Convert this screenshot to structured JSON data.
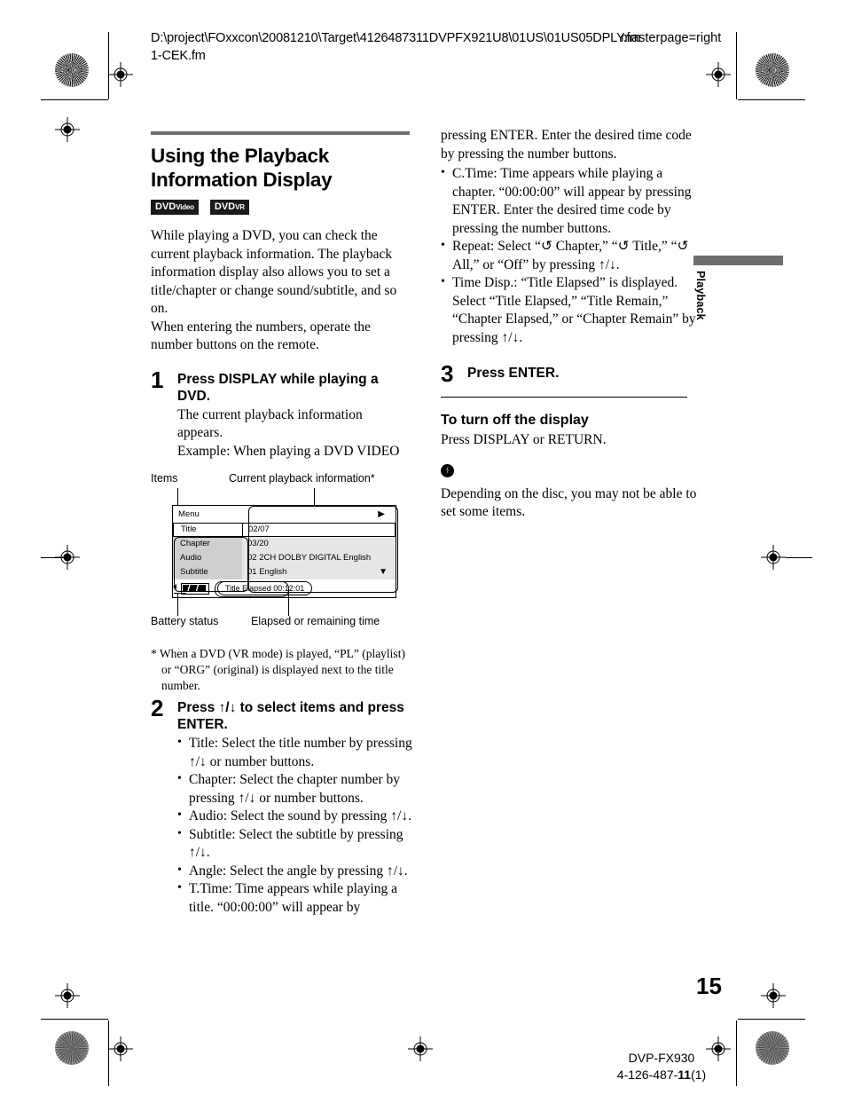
{
  "proof": {
    "path_line1": "D:\\project\\FOxxcon\\20081210\\Target\\4126487311DVPFX921U8\\01US\\01US05DPLY.fm",
    "path_line2": "1-CEK.fm",
    "overlay": "masterpage=right"
  },
  "left_column": {
    "title": "Using the Playback Information Display",
    "badges": [
      {
        "main": "DVD",
        "sub": "Video"
      },
      {
        "main": "DVD",
        "sub": "VR"
      }
    ],
    "intro_paragraph": "While playing a DVD, you can check the current playback information. The playback information display also allows you to set a title/chapter or change sound/subtitle, and so on.",
    "intro_paragraph2": "When entering the numbers, operate the number buttons on the remote.",
    "step1": {
      "number": "1",
      "heading": "Press DISPLAY while playing a DVD.",
      "text_line1": "The current playback information appears.",
      "text_line2": "Example: When playing a DVD VIDEO"
    },
    "footnote": "* When a DVD (VR mode) is played, “PL” (playlist) or “ORG” (original) is displayed next to the title number.",
    "step2": {
      "number": "2",
      "heading": "Press ↑/↓ to select items and press ENTER.",
      "bullets": [
        "Title: Select the title number by pressing ↑/↓ or number buttons.",
        "Chapter: Select the chapter number by pressing ↑/↓ or number buttons.",
        "Audio: Select the sound by pressing ↑/↓.",
        "Subtitle: Select the subtitle by pressing ↑/↓.",
        "Angle: Select the angle by pressing ↑/↓.",
        "T.Time: Time appears while playing a title. “00:00:00” will appear by"
      ]
    }
  },
  "figure": {
    "label_items": "Items",
    "label_info": "Current playback information*",
    "label_battery": "Battery status",
    "label_time": "Elapsed or remaining time",
    "osd": {
      "menu_label": "Menu",
      "play_icon": "▶",
      "down_icon": "▼",
      "rows": [
        {
          "item": "Title",
          "value": "02/07",
          "selected": true
        },
        {
          "item": "Chapter",
          "value": "03/20",
          "selected": false
        },
        {
          "item": "Audio",
          "value": "02 2CH DOLBY DIGITAL English",
          "selected": false
        },
        {
          "item": "Subtitle",
          "value": "01 English",
          "selected": false
        }
      ],
      "time_text": "Title Elapsed 00:12:01"
    }
  },
  "right_column": {
    "continued_text": "pressing ENTER. Enter the desired time code by pressing the number buttons.",
    "bullets": [
      "C.Time: Time appears while playing a chapter. “00:00:00” will appear by pressing ENTER. Enter the desired time code by pressing the number buttons.",
      "Repeat: Select “↺ Chapter,” “↺ Title,” “↺ All,” or “Off” by pressing ↑/↓.",
      "Time Disp.: “Title Elapsed” is displayed. Select “Title Elapsed,” “Title Remain,” “Chapter Elapsed,” or “Chapter Remain” by pressing ↑/↓."
    ],
    "step3": {
      "number": "3",
      "heading": "Press ENTER."
    },
    "turn_off_heading": "To turn off the display",
    "turn_off_text": "Press DISPLAY or RETURN.",
    "note_text": "Depending on the disc, you may not be able to set some items."
  },
  "side_tab": {
    "label": "Playback"
  },
  "footer": {
    "page_number": "15",
    "model": "DVP-FX930",
    "code_prefix": "4-126-487-",
    "code_bold": "11",
    "code_suffix": "(1)"
  }
}
